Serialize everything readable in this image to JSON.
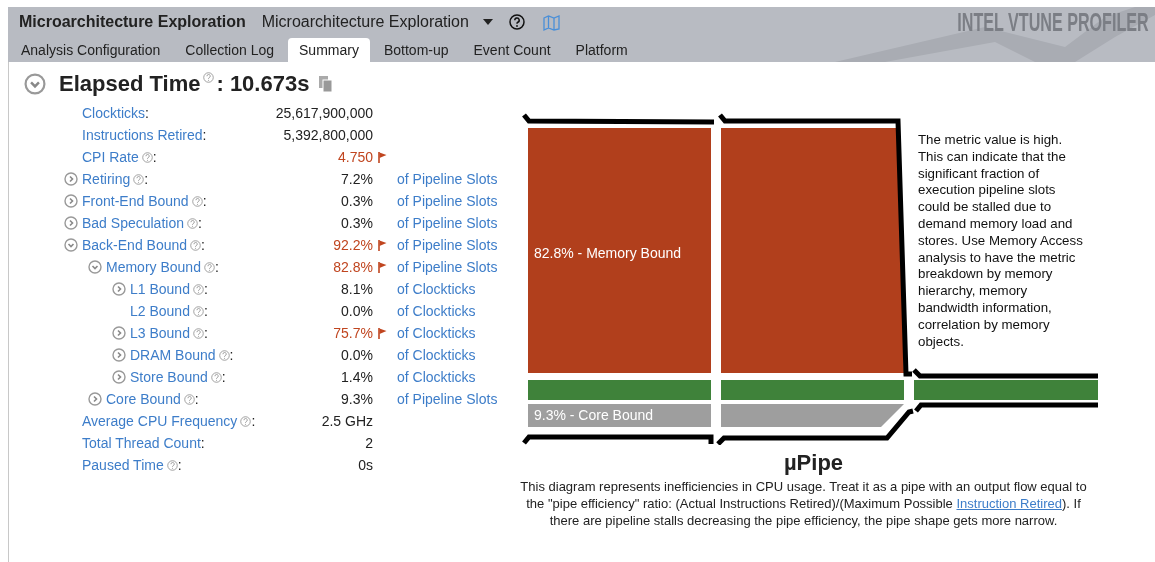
{
  "app": {
    "title": "Microarchitecture Exploration",
    "analysis_type": "Microarchitecture Exploration",
    "brand": "INTEL VTUNE PROFILER"
  },
  "tabs": [
    {
      "label": "Analysis Configuration",
      "selected": false
    },
    {
      "label": "Collection Log",
      "selected": false
    },
    {
      "label": "Summary",
      "selected": true
    },
    {
      "label": "Bottom-up",
      "selected": false
    },
    {
      "label": "Event Count",
      "selected": false
    },
    {
      "label": "Platform",
      "selected": false
    }
  ],
  "summary": {
    "title": "Elapsed Time",
    "expanded": true,
    "help": true,
    "colon": ":",
    "value": "10.673s",
    "metrics": [
      {
        "label": "Clockticks",
        "help": false,
        "colon": ":",
        "value": "25,617,900,000",
        "flagged": false
      },
      {
        "label": "Instructions Retired",
        "help": false,
        "colon": ":",
        "value": "5,392,800,000",
        "flagged": false
      },
      {
        "label": "CPI Rate",
        "help": true,
        "colon": ":",
        "value": "4.750",
        "flagged": true
      },
      {
        "label": "Retiring",
        "help": true,
        "colon": ":",
        "value": "7.2%",
        "flagged": false,
        "unit": "of Pipeline Slots",
        "expanded": false
      },
      {
        "label": "Front-End Bound",
        "help": true,
        "colon": ":",
        "value": "0.3%",
        "flagged": false,
        "unit": "of Pipeline Slots",
        "expanded": false
      },
      {
        "label": "Bad Speculation",
        "help": true,
        "colon": ":",
        "value": "0.3%",
        "flagged": false,
        "unit": "of Pipeline Slots",
        "expanded": false
      },
      {
        "label": "Back-End Bound",
        "help": true,
        "colon": ":",
        "value": "92.2%",
        "flagged": true,
        "unit": "of Pipeline Slots",
        "expanded": true,
        "children": [
          {
            "label": "Memory Bound",
            "help": true,
            "colon": ":",
            "value": "82.8%",
            "flagged": true,
            "unit": "of Pipeline Slots",
            "expanded": true,
            "children": [
              {
                "label": "L1 Bound",
                "help": true,
                "colon": ":",
                "value": "8.1%",
                "flagged": false,
                "unit": "of Clockticks",
                "expanded": false
              },
              {
                "label": "L2 Bound",
                "help": true,
                "colon": ":",
                "value": "0.0%",
                "flagged": false,
                "unit": "of Clockticks"
              },
              {
                "label": "L3 Bound",
                "help": true,
                "colon": ":",
                "value": "75.7%",
                "flagged": true,
                "unit": "of Clockticks",
                "expanded": false
              },
              {
                "label": "DRAM Bound",
                "help": true,
                "colon": ":",
                "value": "0.0%",
                "flagged": false,
                "unit": "of Clockticks",
                "expanded": false
              },
              {
                "label": "Store Bound",
                "help": true,
                "colon": ":",
                "value": "1.4%",
                "flagged": false,
                "unit": "of Clockticks",
                "expanded": false
              }
            ]
          },
          {
            "label": "Core Bound",
            "help": true,
            "colon": ":",
            "value": "9.3%",
            "flagged": false,
            "unit": "of Pipeline Slots",
            "expanded": false
          }
        ]
      },
      {
        "label": "Average CPU Frequency",
        "help": true,
        "colon": ":",
        "value": "2.5 GHz",
        "flagged": false
      },
      {
        "label": "Total Thread Count",
        "help": false,
        "colon": ":",
        "value": "2",
        "flagged": false
      },
      {
        "label": "Paused Time",
        "help": true,
        "colon": ":",
        "value": "0s",
        "flagged": false
      }
    ]
  },
  "pipe": {
    "memory_label": "82.8% - Memory Bound",
    "core_label": "9.3% - Core Bound",
    "tooltip": "The metric value is high. This can indicate that the significant fraction of execution pipeline slots could be stalled due to demand memory load and stores. Use Memory Access analysis to have the metric breakdown by memory hierarchy, memory bandwidth information, correlation by memory objects.",
    "title": "µPipe",
    "caption_before": "This diagram represents inefficiencies in CPU usage. Treat it as a pipe with an output flow equal to the \"pipe efficiency\" ratio: (Actual Instructions Retired)/(Maximum Possible ",
    "caption_link": "Instruction Retired",
    "caption_after": "). If there are pipeline stalls decreasing the pipe efficiency, the pipe shape gets more narrow."
  }
}
